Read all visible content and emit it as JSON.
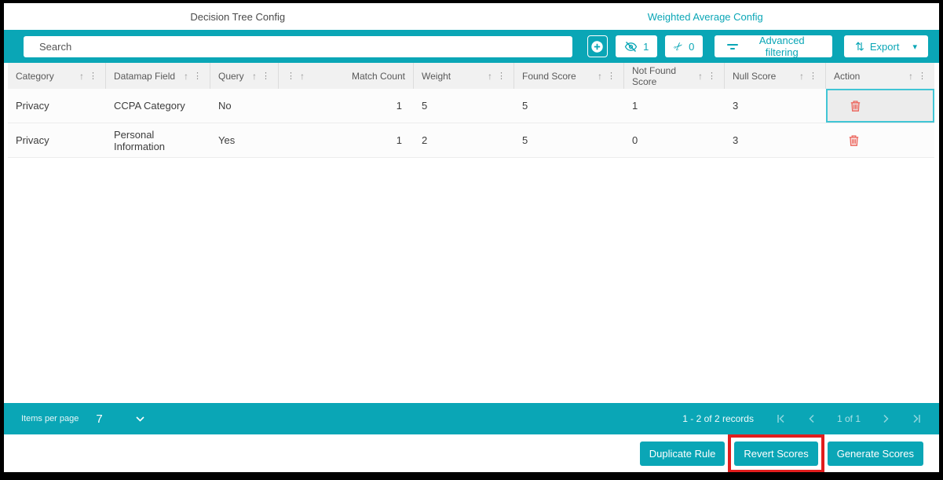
{
  "tabs": [
    {
      "label": "Decision Tree Config",
      "active": false
    },
    {
      "label": "Weighted Average Config",
      "active": true
    }
  ],
  "toolbar": {
    "search_placeholder": "Search",
    "hidden_count": "1",
    "cut_count": "0",
    "advanced_filtering_label": "Advanced filtering",
    "export_label": "Export"
  },
  "table": {
    "columns": [
      {
        "label": "Category",
        "align": "left"
      },
      {
        "label": "Datamap Field",
        "align": "left"
      },
      {
        "label": "Query",
        "align": "left"
      },
      {
        "label": "Match Count",
        "align": "right"
      },
      {
        "label": "Weight",
        "align": "left"
      },
      {
        "label": "Found Score",
        "align": "left"
      },
      {
        "label": "Not Found Score",
        "align": "left"
      },
      {
        "label": "Null Score",
        "align": "left"
      },
      {
        "label": "Action",
        "align": "left"
      }
    ],
    "rows": [
      {
        "category": "Privacy",
        "datamap_field": "CCPA Category",
        "query": "No",
        "match_count": "1",
        "weight": "5",
        "found_score": "5",
        "not_found_score": "1",
        "null_score": "3"
      },
      {
        "category": "Privacy",
        "datamap_field": "Personal Information",
        "query": "Yes",
        "match_count": "1",
        "weight": "2",
        "found_score": "5",
        "not_found_score": "0",
        "null_score": "3"
      }
    ]
  },
  "footer": {
    "items_per_page_label": "Items per page",
    "items_per_page_value": "7",
    "records_text": "1 - 2 of 2 records",
    "page_text": "1 of 1"
  },
  "actions": {
    "duplicate_label": "Duplicate Rule",
    "revert_label": "Revert Scores",
    "generate_label": "Generate Scores"
  },
  "colors": {
    "teal": "#0aa6b6",
    "trash_red": "#ec655c",
    "annotation_red": "#e11d1d",
    "focus_border": "#41c5d5"
  }
}
